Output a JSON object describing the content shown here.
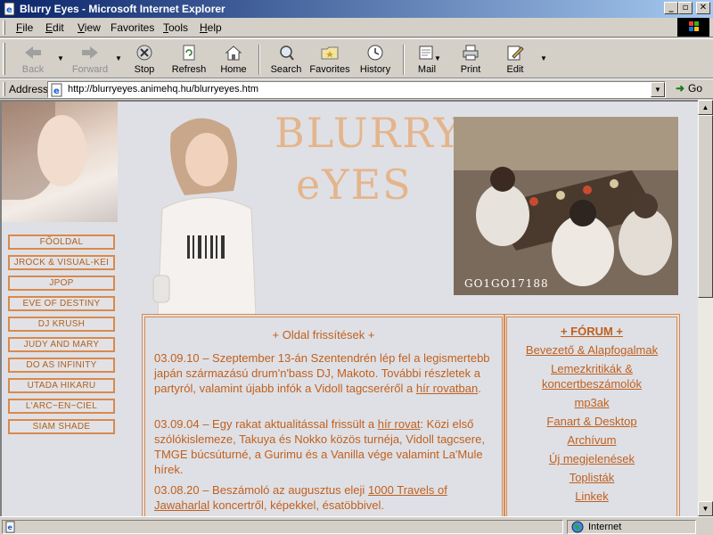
{
  "window": {
    "title": "Blurry Eyes - Microsoft Internet Explorer",
    "buttons": [
      "_",
      "▫",
      "✕"
    ]
  },
  "menu": [
    {
      "label": "File",
      "key": "F",
      "rest": "ile"
    },
    {
      "label": "Edit",
      "key": "E",
      "rest": "dit"
    },
    {
      "label": "View",
      "key": "V",
      "rest": "iew"
    },
    {
      "label": "Favorites",
      "key": "",
      "rest": "Favorites"
    },
    {
      "label": "Tools",
      "key": "T",
      "rest": "ools"
    },
    {
      "label": "Help",
      "key": "H",
      "rest": "elp"
    }
  ],
  "toolbar": {
    "back": "Back",
    "forward": "Forward",
    "stop": "Stop",
    "refresh": "Refresh",
    "home": "Home",
    "search": "Search",
    "favorites": "Favorites",
    "history": "History",
    "mail": "Mail",
    "print": "Print",
    "edit": "Edit"
  },
  "address": {
    "label": "Address",
    "url": "http://blurryeyes.animehq.hu/blurryeyes.htm",
    "go": "Go"
  },
  "status": {
    "zone": "Internet"
  },
  "page": {
    "logo_line1": "BLURRY",
    "logo_line2": "eYES",
    "photo_caption": "GO1GO17188",
    "nav": [
      "FŐOLDAL",
      "JROCK & VISUAL-KEI",
      "JPOP",
      "EVE OF DESTINY",
      "DJ KRUSH",
      "JUDY AND MARY",
      "DO AS INFINITY",
      "UTADA HIKARU",
      "L'ARC~EN~CIEL",
      "SIAM SHADE"
    ],
    "news": {
      "heading": "+ Oldal frissítések +",
      "items": [
        {
          "text": "03.09.10 – Szeptember 13-án Szentendrén lép fel a legismertebb japán származású drum'n'bass DJ, Makoto. További részletek a partyról, valamint újabb infók a Vidoll tagcseréről a ",
          "link": "hír rovatban",
          "after": "."
        },
        {
          "text": "03.09.04 – Egy rakat aktualitással frissült a ",
          "link": "hír rovat",
          "after": ": Közi első szólókislemeze, Takuya és Nokko közös turnéja, Vidoll tagcsere, TMGE búcsúturné, a Gurimu és a Vanilla vége valamint La'Mule hírek."
        },
        {
          "text": "03.08.20 – Beszámoló az augusztus eleji ",
          "link": "1000 Travels of Jawaharlal",
          "after": " koncertről, képekkel, ésatöbbivel."
        }
      ]
    },
    "forum": {
      "heading": "+ FÓRUM +",
      "links": [
        "Bevezető & Alapfogalmak",
        "Lemezkritikák & koncertbeszámolók",
        "mp3ak",
        "Fanart & Desktop",
        "Archívum",
        "Új megjelenések",
        "Toplisták",
        "Linkek"
      ]
    }
  },
  "colors": {
    "accent": "#c0601e",
    "border": "#d9894c",
    "page_bg": "#dfe0e5",
    "logo": "#e4b58b",
    "titlebar": "#0a246a"
  }
}
